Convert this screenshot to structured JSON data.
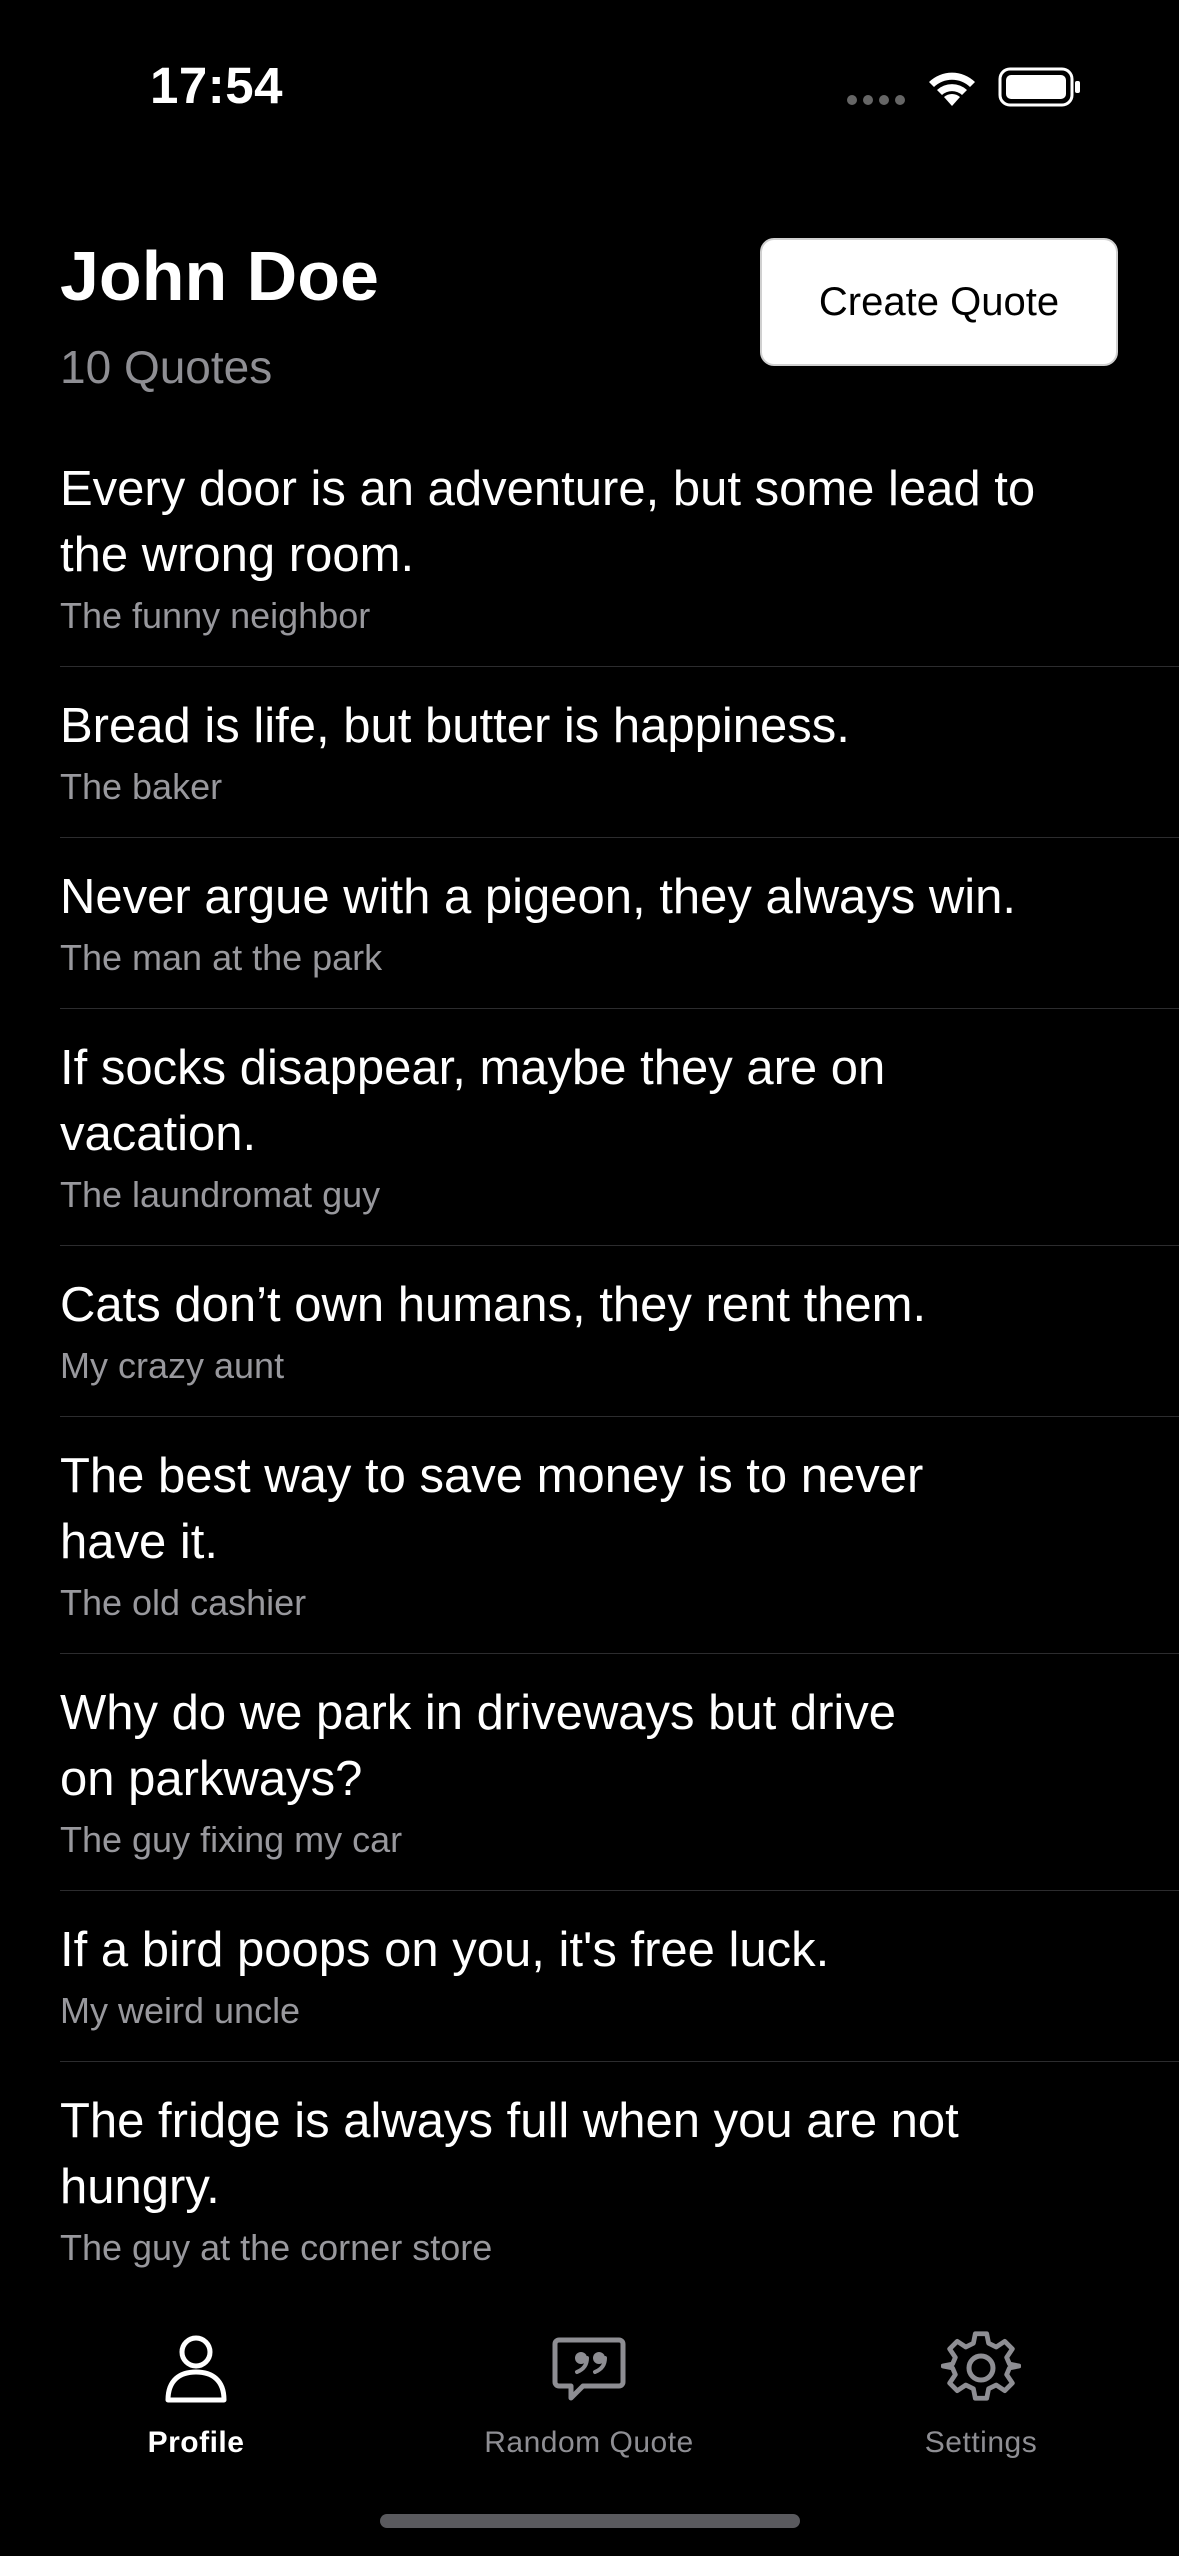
{
  "status_bar": {
    "time": "17:54"
  },
  "header": {
    "name": "John Doe",
    "quote_count": "10 Quotes",
    "create_button_label": "Create Quote"
  },
  "quotes": [
    {
      "text": "Every door is an adventure, but some lead to the wrong room.",
      "author": "The funny neighbor"
    },
    {
      "text": "Bread is life, but butter is happiness.",
      "author": "The baker"
    },
    {
      "text": "Never argue with a pigeon, they always win.",
      "author": "The man at the park"
    },
    {
      "text": "If socks disappear, maybe they are on vacation.",
      "author": "The laundromat guy"
    },
    {
      "text": "Cats don’t own humans, they rent them.",
      "author": "My crazy aunt"
    },
    {
      "text": "The best way to save money is to never have it.",
      "author": "The old cashier"
    },
    {
      "text": "Why do we park in driveways but drive on parkways?",
      "author": "The guy fixing my car"
    },
    {
      "text": "If a bird poops on you, it's free luck.",
      "author": "My weird uncle"
    },
    {
      "text": "The fridge is always full when you are not hungry.",
      "author": "The guy at the corner store"
    }
  ],
  "tab_bar": {
    "tabs": [
      {
        "label": "Profile",
        "icon": "person-icon",
        "active": true
      },
      {
        "label": "Random Quote",
        "icon": "quote-bubble-icon",
        "active": false
      },
      {
        "label": "Settings",
        "icon": "gear-icon",
        "active": false
      }
    ]
  },
  "colors": {
    "background": "#000000",
    "primary_text": "#ffffff",
    "secondary_text": "#8e8e93",
    "separator": "#2c2c2e",
    "button_background": "#ffffff"
  }
}
